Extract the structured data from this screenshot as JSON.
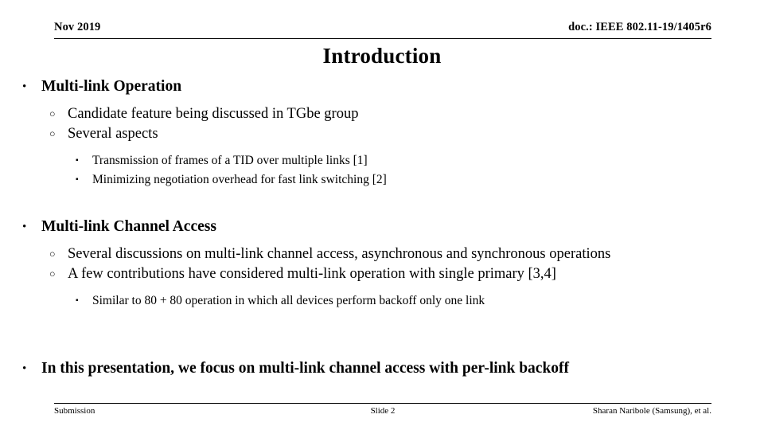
{
  "header": {
    "date": "Nov 2019",
    "doc_reference": "doc.: IEEE 802.11-19/1405r6"
  },
  "title": "Introduction",
  "markers": {
    "level1": "•",
    "level2": "○",
    "level3": "▪"
  },
  "content": {
    "section1": {
      "heading": "Multi-link Operation",
      "sub1": "Candidate feature being discussed in TGbe group",
      "sub2": "Several aspects",
      "detail1": "Transmission of frames of a TID over multiple links [1]",
      "detail2": "Minimizing negotiation overhead for fast link switching [2]"
    },
    "section2": {
      "heading": "Multi-link Channel Access",
      "sub1": "Several discussions on multi-link channel access, asynchronous and synchronous operations",
      "sub2": "A few contributions have considered multi-link operation with single primary [3,4]",
      "detail1": "Similar to 80 + 80 operation in which all devices perform backoff only one link"
    },
    "section3": {
      "heading": "In this presentation, we focus on multi-link channel access with per-link backoff"
    }
  },
  "footer": {
    "left": "Submission",
    "center": "Slide 2",
    "right": "Sharan Naribole (Samsung), et al."
  }
}
